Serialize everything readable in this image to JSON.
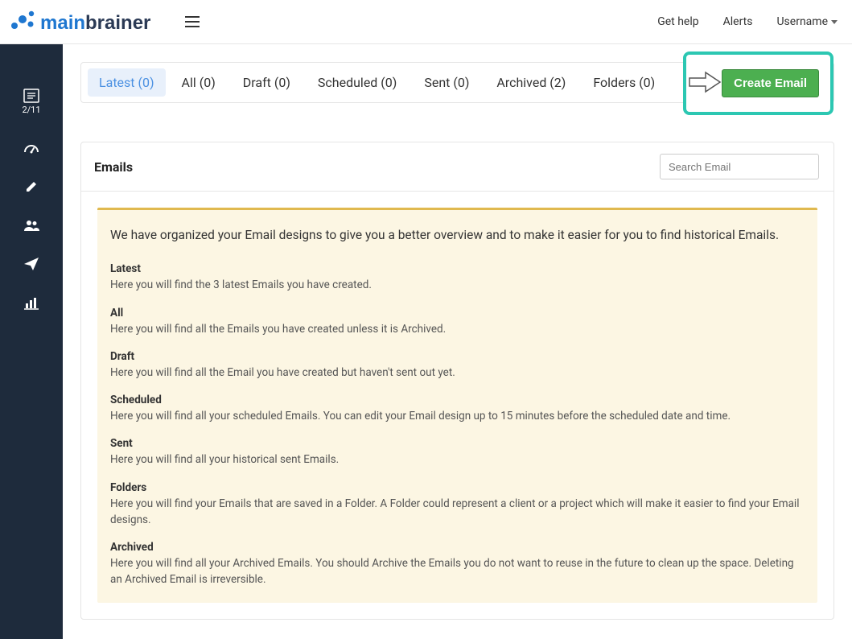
{
  "header": {
    "getHelp": "Get help",
    "alerts": "Alerts",
    "username": "Username"
  },
  "sidebar": {
    "counter": "2/11"
  },
  "tabs": [
    {
      "key": "latest",
      "label": "Latest (0)",
      "active": true
    },
    {
      "key": "all",
      "label": "All (0)",
      "active": false
    },
    {
      "key": "draft",
      "label": "Draft (0)",
      "active": false
    },
    {
      "key": "scheduled",
      "label": "Scheduled (0)",
      "active": false
    },
    {
      "key": "sent",
      "label": "Sent (0)",
      "active": false
    },
    {
      "key": "archived",
      "label": "Archived (2)",
      "active": false
    },
    {
      "key": "folders",
      "label": "Folders (0)",
      "active": false
    }
  ],
  "createButton": "Create Email",
  "panel": {
    "title": "Emails",
    "searchPlaceholder": "Search Email"
  },
  "info": {
    "lead": "We have organized your Email designs to give you a better overview and to make it easier for you to find historical Emails.",
    "sections": [
      {
        "title": "Latest",
        "text": "Here you will find the 3 latest Emails you have created."
      },
      {
        "title": "All",
        "text": "Here you will find all the Emails you have created unless it is Archived."
      },
      {
        "title": "Draft",
        "text": "Here you will find all the Email you have created but haven't sent out yet."
      },
      {
        "title": "Scheduled",
        "text": "Here you will find all your scheduled Emails. You can edit your Email design up to 15 minutes before the scheduled date and time."
      },
      {
        "title": "Sent",
        "text": "Here you will find all your historical sent Emails."
      },
      {
        "title": "Folders",
        "text": "Here you will find your Emails that are saved in a Folder. A Folder could represent a client or a project which will make it easier to find your Email designs."
      },
      {
        "title": "Archived",
        "text": "Here you will find all your Archived Emails. You should Archive the Emails you do not want to reuse in the future to clean up the space. Deleting an Archived Email is irreversible."
      }
    ]
  }
}
